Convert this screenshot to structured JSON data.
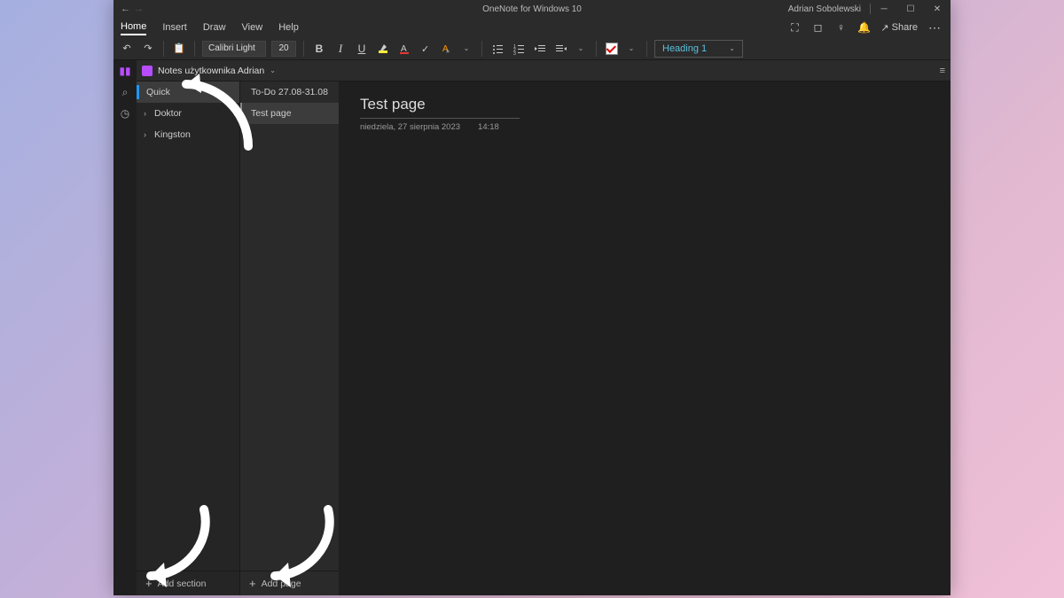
{
  "titlebar": {
    "app_title": "OneNote for Windows 10",
    "user_name": "Adrian Sobolewski"
  },
  "menu": {
    "tabs": [
      "Home",
      "Insert",
      "Draw",
      "View",
      "Help"
    ],
    "active_index": 0,
    "share_label": "Share"
  },
  "ribbon": {
    "font_name": "Calibri Light",
    "font_size": "20",
    "style_label": "Heading 1"
  },
  "notebook": {
    "name": "Notes użytkownika Adrian"
  },
  "sections": {
    "items": [
      {
        "label": "Quick",
        "expandable": false,
        "active": true
      },
      {
        "label": "Doktor",
        "expandable": true,
        "active": false
      },
      {
        "label": "Kingston",
        "expandable": true,
        "active": false
      }
    ],
    "add_label": "Add section"
  },
  "pages": {
    "items": [
      {
        "label": "To-Do 27.08-31.08",
        "active": false
      },
      {
        "label": "Test page",
        "active": true
      }
    ],
    "add_label": "Add page"
  },
  "page": {
    "title": "Test page",
    "date": "niedziela, 27 sierpnia 2023",
    "time": "14:18"
  }
}
